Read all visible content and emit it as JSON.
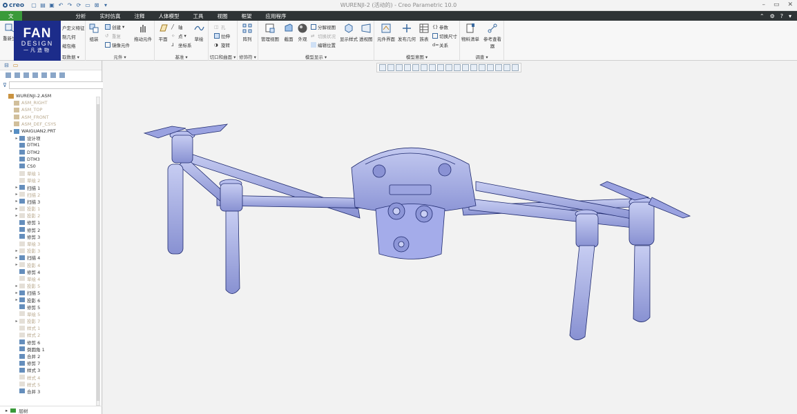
{
  "app": {
    "logo_text": "creo",
    "window_title": "WURENJI-2 (活动的) - Creo Parametric 10.0"
  },
  "menubar": {
    "items": [
      "文",
      "分析",
      "实时仿真",
      "注释",
      "人体模型",
      "工具",
      "视图",
      "框架",
      "应用程序"
    ]
  },
  "brand": {
    "line1": "FAN",
    "line2": "DESIGN",
    "line3": "一凡造物"
  },
  "ribbon": {
    "groups": {
      "get_data": "取数据",
      "component": "元件",
      "datum": "基准",
      "cut_surface": "切口和曲面",
      "modifier": "修饰符",
      "model_display": "模型显示",
      "model_intent": "模型意图",
      "investigate": "调查"
    },
    "buttons": {
      "user_defined": "户定义特征",
      "copy_geom": "制几何",
      "shrinkwrap": "缩包络",
      "assemble": "组装",
      "create": "创建",
      "repeat": "重复",
      "mirror_comp": "镜像元件",
      "drag_comp": "拖动元件",
      "plane": "平面",
      "axis": "轴",
      "point": "点",
      "csys": "坐标系",
      "sketch": "草绘",
      "hole": "孔",
      "extrude": "拉伸",
      "revolve": "旋转",
      "pattern": "阵列",
      "manage_views": "管理视图",
      "section": "截面",
      "appearance": "外观",
      "explode_view": "分解视图",
      "toggle_state": "切换状况",
      "edit_position": "编辑位置",
      "display_style": "显示样式",
      "perspective": "透视图",
      "comp_interface": "元件界面",
      "publish_geom": "发布几何",
      "family_table": "族表",
      "params": "参数",
      "switch_dims": "切换尺寸",
      "relations": "关系",
      "bom": "物料清单",
      "ref_viewer": "参考查看器",
      "regen": "重新生"
    }
  },
  "tree": {
    "filter_placeholder": "",
    "items": [
      {
        "label": "WURENJI-2.ASM",
        "kind": "asm",
        "exp": ""
      },
      {
        "label": "ASM_RIGHT",
        "kind": "datum",
        "exp": ""
      },
      {
        "label": "ASM_TOP",
        "kind": "datum",
        "exp": ""
      },
      {
        "label": "ASM_FRONT",
        "kind": "datum",
        "exp": ""
      },
      {
        "label": "ASM_DEF_CSYS",
        "kind": "datum",
        "exp": ""
      },
      {
        "label": "WAIGUAN2.PRT",
        "kind": "prt",
        "exp": "▾"
      },
      {
        "label": "设计项",
        "kind": "normal",
        "exp": "▸"
      },
      {
        "label": "DTM1",
        "kind": "normal",
        "exp": ""
      },
      {
        "label": "DTM2",
        "kind": "normal",
        "exp": ""
      },
      {
        "label": "DTM3",
        "kind": "normal",
        "exp": ""
      },
      {
        "label": "CS0",
        "kind": "normal",
        "exp": ""
      },
      {
        "label": "草绘 1",
        "kind": "suppressed",
        "exp": ""
      },
      {
        "label": "草绘 2",
        "kind": "suppressed",
        "exp": ""
      },
      {
        "label": "扫描 1",
        "kind": "normal",
        "exp": "▸"
      },
      {
        "label": "扫描 2",
        "kind": "suppressed",
        "exp": "▸"
      },
      {
        "label": "扫描 3",
        "kind": "normal",
        "exp": "▸"
      },
      {
        "label": "投影 1",
        "kind": "suppressed",
        "exp": "▸"
      },
      {
        "label": "投影 2",
        "kind": "suppressed",
        "exp": "▸"
      },
      {
        "label": "修剪 1",
        "kind": "normal",
        "exp": ""
      },
      {
        "label": "修剪 2",
        "kind": "normal",
        "exp": ""
      },
      {
        "label": "修剪 3",
        "kind": "normal",
        "exp": ""
      },
      {
        "label": "草绘 3",
        "kind": "suppressed",
        "exp": ""
      },
      {
        "label": "投影 3",
        "kind": "suppressed",
        "exp": "▸"
      },
      {
        "label": "扫描 4",
        "kind": "normal",
        "exp": "▸"
      },
      {
        "label": "投影 4",
        "kind": "suppressed",
        "exp": "▸"
      },
      {
        "label": "修剪 4",
        "kind": "normal",
        "exp": ""
      },
      {
        "label": "草绘 4",
        "kind": "suppressed",
        "exp": ""
      },
      {
        "label": "投影 5",
        "kind": "suppressed",
        "exp": "▸"
      },
      {
        "label": "扫描 5",
        "kind": "normal",
        "exp": "▸"
      },
      {
        "label": "投影 6",
        "kind": "normal",
        "exp": "▸"
      },
      {
        "label": "修剪 5",
        "kind": "normal",
        "exp": ""
      },
      {
        "label": "草绘 5",
        "kind": "suppressed",
        "exp": ""
      },
      {
        "label": "投影 7",
        "kind": "suppressed",
        "exp": "▸"
      },
      {
        "label": "样式 1",
        "kind": "suppressed",
        "exp": ""
      },
      {
        "label": "样式 2",
        "kind": "suppressed",
        "exp": ""
      },
      {
        "label": "修剪 6",
        "kind": "normal",
        "exp": ""
      },
      {
        "label": "倒圆角 1",
        "kind": "normal",
        "exp": ""
      },
      {
        "label": "合并 2",
        "kind": "normal",
        "exp": ""
      },
      {
        "label": "修剪 7",
        "kind": "normal",
        "exp": ""
      },
      {
        "label": "样式 3",
        "kind": "normal",
        "exp": ""
      },
      {
        "label": "样式 4",
        "kind": "suppressed",
        "exp": ""
      },
      {
        "label": "样式 5",
        "kind": "suppressed",
        "exp": ""
      },
      {
        "label": "合并 3",
        "kind": "normal",
        "exp": ""
      }
    ]
  },
  "layer_tree": {
    "label": "层树"
  },
  "colors": {
    "menubar_bg": "#2f3436",
    "file_tab": "#3a9a3a",
    "model_fill": "#a9b1e6",
    "model_edge": "#1f2a6e",
    "brand_bg": "#1c2c8a"
  }
}
